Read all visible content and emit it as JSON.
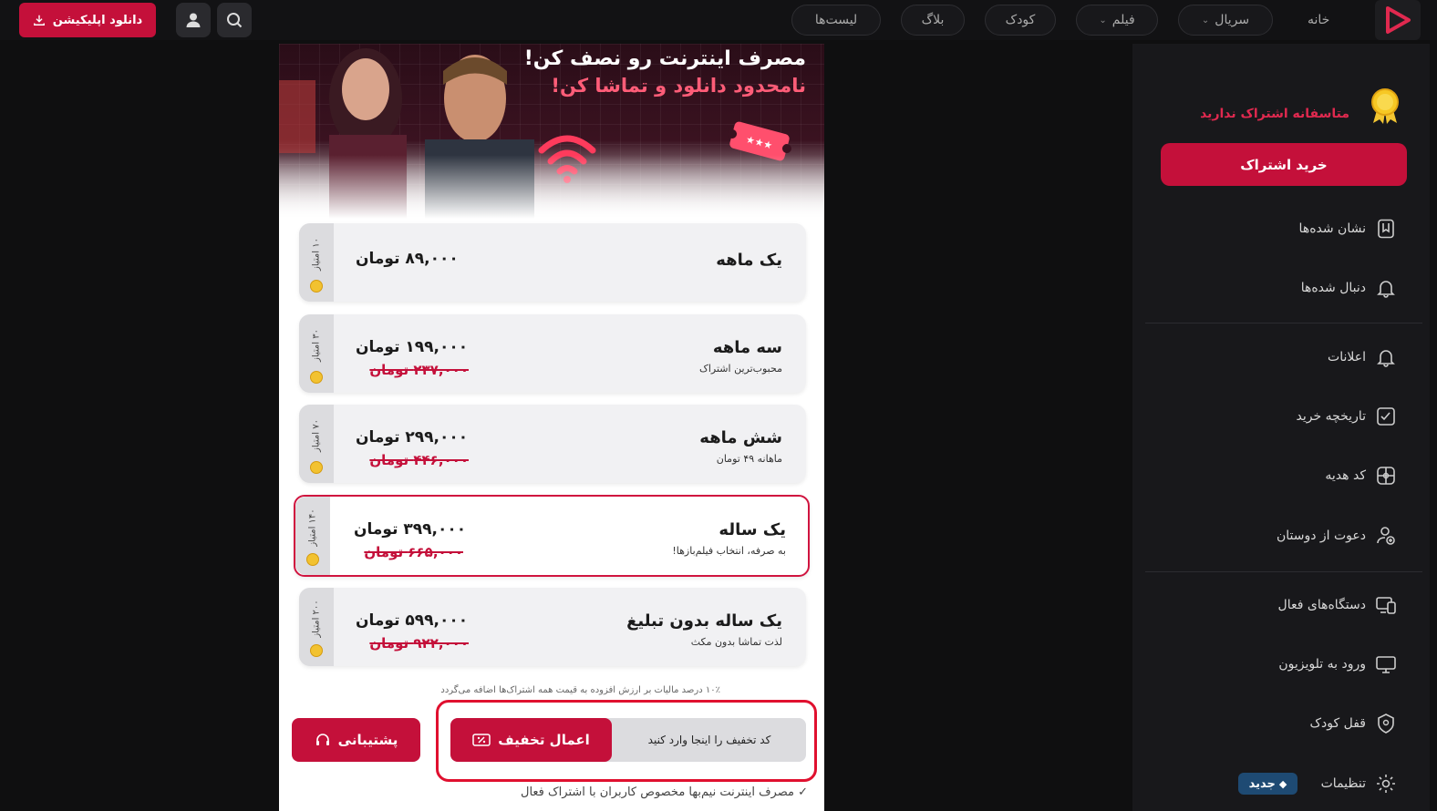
{
  "header": {
    "download_app": "دانلود اپلیکیشن",
    "nav": [
      {
        "label": "خانه"
      },
      {
        "label": "سریال"
      },
      {
        "label": "فیلم"
      },
      {
        "label": "کودک"
      },
      {
        "label": "بلاگ"
      },
      {
        "label": "لیست‌ها"
      }
    ]
  },
  "sidebar": {
    "no_subscription": "متاسفانه اشتراک ندارید",
    "buy_button": "خرید اشتراک",
    "items": [
      {
        "label": "نشان شده‌ها",
        "icon": "bookmark-icon"
      },
      {
        "label": "دنبال شده‌ها",
        "icon": "bell-icon"
      },
      {
        "label": "اعلانات",
        "icon": "bell-icon"
      },
      {
        "label": "تاریخچه خرید",
        "icon": "receipt-icon"
      },
      {
        "label": "کد هدیه",
        "icon": "gift-icon"
      },
      {
        "label": "دعوت از دوستان",
        "icon": "user-add-icon"
      },
      {
        "label": "دستگاه‌های فعال",
        "icon": "devices-icon"
      },
      {
        "label": "ورود به تلویزیون",
        "icon": "tv-icon"
      },
      {
        "label": "قفل کودک",
        "icon": "shield-icon"
      },
      {
        "label": "تنظیمات",
        "icon": "gear-icon"
      }
    ],
    "new_badge": "جدید"
  },
  "banner": {
    "line1": "مصرف اینترنت رو نصف کن!",
    "line2": "نامحدود دانلود و تماشا کن!"
  },
  "plans": [
    {
      "title": "یک ماهه",
      "subtitle": "",
      "price": "۸۹,۰۰۰ تومان",
      "old_price": "",
      "points": "۱۰ امتیاز"
    },
    {
      "title": "سه ماهه",
      "subtitle": "محبوب‌ترین اشتراک",
      "price": "۱۹۹,۰۰۰ تومان",
      "old_price": "۲۳۷,۰۰۰ تومان",
      "points": "۳۰ امتیاز"
    },
    {
      "title": "شش ماهه",
      "subtitle": "ماهانه ۴۹ تومان",
      "price": "۲۹۹,۰۰۰ تومان",
      "old_price": "۴۴۶,۰۰۰ تومان",
      "points": "۷۰ امتیاز"
    },
    {
      "title": "یک ساله",
      "subtitle": "به صرفه، انتخاب فیلم‌بازها!",
      "price": "۳۹۹,۰۰۰ تومان",
      "old_price": "۶۶۵,۰۰۰ تومان",
      "points": "۱۴۰ امتیاز"
    },
    {
      "title": "یک ساله بدون تبلیغ",
      "subtitle": "لذت تماشا بدون مکث",
      "price": "۵۹۹,۰۰۰ تومان",
      "old_price": "۹۲۲,۰۰۰ تومان",
      "points": "۲۰۰ امتیاز"
    }
  ],
  "tax_note": "۱۰٪ درصد مالیات بر ارزش افزوده به قیمت همه اشتراک‌ها اضافه می‌گردد",
  "support_button": "پشتیبانی",
  "discount": {
    "placeholder": "کد تخفیف را اینجا وارد کنید",
    "apply_button": "اعمال تخفیف"
  },
  "footnote": "✓ مصرف اینترنت نیم‌بها مخصوص کاربران با اشتراک فعال",
  "colors": {
    "accent": "#c4103a",
    "highlight": "#e0294f",
    "badge": "#1e4a73"
  }
}
